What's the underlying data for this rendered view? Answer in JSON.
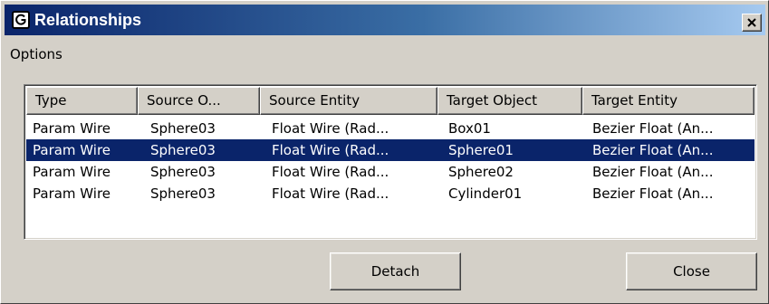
{
  "window": {
    "title": "Relationships",
    "close_glyph": "×",
    "icon": "app-logo-icon"
  },
  "menu": {
    "items": [
      {
        "label": "Options"
      }
    ]
  },
  "table": {
    "columns": [
      {
        "label": "Type"
      },
      {
        "label": "Source O..."
      },
      {
        "label": "Source Entity"
      },
      {
        "label": "Target Object"
      },
      {
        "label": "Target Entity"
      }
    ],
    "rows": [
      {
        "type": "Param Wire",
        "source_object": "Sphere03",
        "source_entity": "Float Wire (Rad...",
        "target_object": "Box01",
        "target_entity": "Bezier Float (An..."
      },
      {
        "type": "Param Wire",
        "source_object": "Sphere03",
        "source_entity": "Float Wire (Rad...",
        "target_object": "Sphere01",
        "target_entity": "Bezier Float (An..."
      },
      {
        "type": "Param Wire",
        "source_object": "Sphere03",
        "source_entity": "Float Wire (Rad...",
        "target_object": "Sphere02",
        "target_entity": "Bezier Float (An..."
      },
      {
        "type": "Param Wire",
        "source_object": "Sphere03",
        "source_entity": "Float Wire (Rad...",
        "target_object": "Cylinder01",
        "target_entity": "Bezier Float (An..."
      }
    ],
    "selected_row_index": 1
  },
  "buttons": {
    "detach_label": "Detach",
    "close_label": "Close"
  },
  "colors": {
    "selection_bg": "#0a246a",
    "title_gradient_start": "#0a246a",
    "title_gradient_end": "#a6caf0",
    "face": "#d4d0c8"
  }
}
